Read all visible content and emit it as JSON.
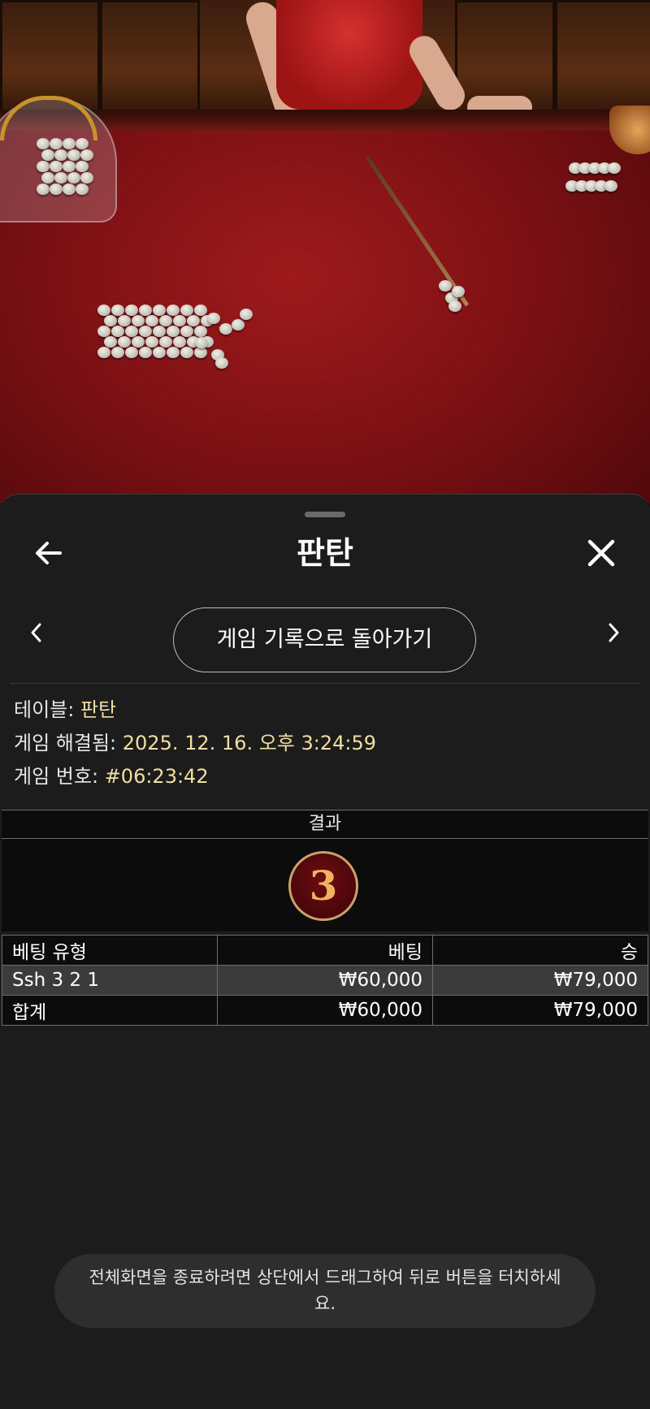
{
  "header": {
    "title": "판탄"
  },
  "nav": {
    "back_history_label": "게임 기록으로 돌아가기"
  },
  "info": {
    "table_label": "테이블:",
    "table_value": "판탄",
    "resolved_label": "게임 해결됨:",
    "resolved_value": "2025. 12. 16. 오후 3:24:59",
    "game_no_label": "게임 번호:",
    "game_no_value": "#06:23:42"
  },
  "result": {
    "heading": "결과",
    "value": "3"
  },
  "bets_table": {
    "columns": [
      "베팅 유형",
      "베팅",
      "승"
    ],
    "rows": [
      {
        "type": "Ssh 3 2 1",
        "bet": "₩60,000",
        "win": "₩79,000"
      },
      {
        "type": "합계",
        "bet": "₩60,000",
        "win": "₩79,000"
      }
    ]
  },
  "toast": {
    "text": "전체화면을 종료하려면 상단에서 드래그하여 뒤로 버튼을 터치하세요."
  },
  "icons": {
    "back": "arrow-left-icon",
    "close": "close-icon",
    "prev": "chevron-left-icon",
    "next": "chevron-right-icon"
  },
  "colors": {
    "sheet_bg": "#1c1c1c",
    "value_text": "#f1dfa2",
    "medal_bg": "#6e0c12",
    "medal_border": "#cda06a",
    "medal_text": "#f0b25c",
    "selected_row": "#3b3b3b"
  }
}
